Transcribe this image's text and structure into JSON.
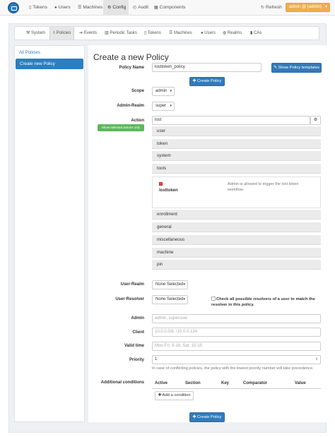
{
  "topnav": {
    "tokens": "Tokens",
    "users": "Users",
    "machines": "Machines",
    "config": "Config",
    "audit": "Audit",
    "components": "Components",
    "refresh": "Refresh",
    "admin_menu": "admin @ (admin)"
  },
  "subnav": {
    "system": "System",
    "policies": "Policies",
    "events": "Events",
    "periodic_tasks": "Periodic Tasks",
    "tokens": "Tokens",
    "machines": "Machines",
    "users": "Users",
    "realms": "Realms",
    "cas": "CAs"
  },
  "sidebar": {
    "items": [
      {
        "label": "All Policies"
      },
      {
        "label": "Create new Policy"
      }
    ]
  },
  "form": {
    "title": "Create a new Policy",
    "policy_name_label": "Policy Name",
    "policy_name_value": "losttoken_policy",
    "show_templates": "Show Policy templates",
    "create_policy": "Create Policy",
    "scope_label": "Scope",
    "scope_value": "admin",
    "admin_realm_label": "Admin-Realm",
    "admin_realm_value": "super",
    "action_label": "Action",
    "action_filter_value": "lost",
    "show_selected": "Show selected actions only",
    "sections": [
      "user",
      "token",
      "system",
      "tools",
      "enrollment",
      "general",
      "miscellaneous",
      "machine",
      "pin"
    ],
    "tools_action": {
      "name": "losttoken",
      "description_line1": "Admin is allowed to trigger the lost token",
      "description_line2": "workflow."
    },
    "user_realm_label": "User-Realm",
    "user_realm_value": "None Selected",
    "user_resolver_label": "User-Resolver",
    "user_resolver_value": "None Selected",
    "check_resolvers_line1": "Check all possible resolvers of a user to match the",
    "check_resolvers_line2": "resolver in this policy.",
    "admin_label": "Admin",
    "admin_placeholder": "admin, superuser",
    "client_label": "Client",
    "client_placeholder": "10.0.0.0/8, !10.0.0.124",
    "valid_time_label": "Valid time",
    "valid_time_placeholder": "Mon-Fri: 9-18, Sat: 10-15",
    "priority_label": "Priority",
    "priority_value": "1",
    "priority_help": "In case of conflicting policies, the policy with the lowest priority number will take precedence.",
    "additional_conditions_label": "Additional conditions",
    "conditions_headers": [
      "Active",
      "Section",
      "Key",
      "Comparator",
      "Value"
    ],
    "add_condition": "Add a condition"
  },
  "colors": {
    "primary": "#337ab7",
    "success": "#5cb85c",
    "warning": "#f0ad4e",
    "danger": "#d9534f"
  }
}
